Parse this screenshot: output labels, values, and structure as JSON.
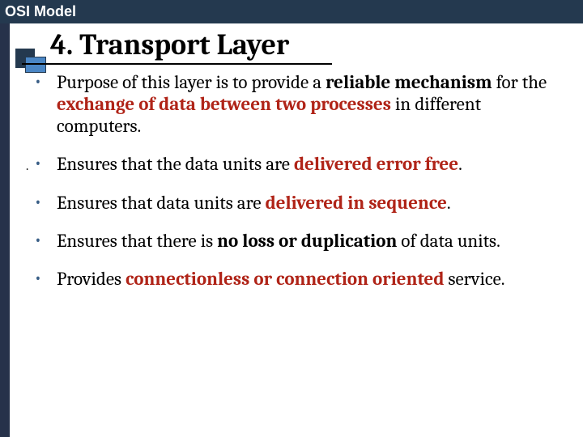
{
  "header": {
    "title": "OSI Model"
  },
  "slide": {
    "title": "4. Transport Layer",
    "bullets": [
      {
        "pre": "Purpose of this layer is to provide a ",
        "b1": "reliable mechanism",
        "mid1": " for the ",
        "r1": "exchange of data between two processes",
        "post": " in different computers."
      },
      {
        "pre": "Ensures that the data units are ",
        "r1": "delivered error free",
        "post": "."
      },
      {
        "pre": "Ensures that data units are ",
        "r1": "delivered in sequence",
        "post": "."
      },
      {
        "pre": "Ensures that there is ",
        "b1": "no loss or duplication",
        "post": " of data units."
      },
      {
        "pre": "Provides ",
        "r1": "connectionless or connection oriented",
        "post": " service."
      }
    ]
  }
}
